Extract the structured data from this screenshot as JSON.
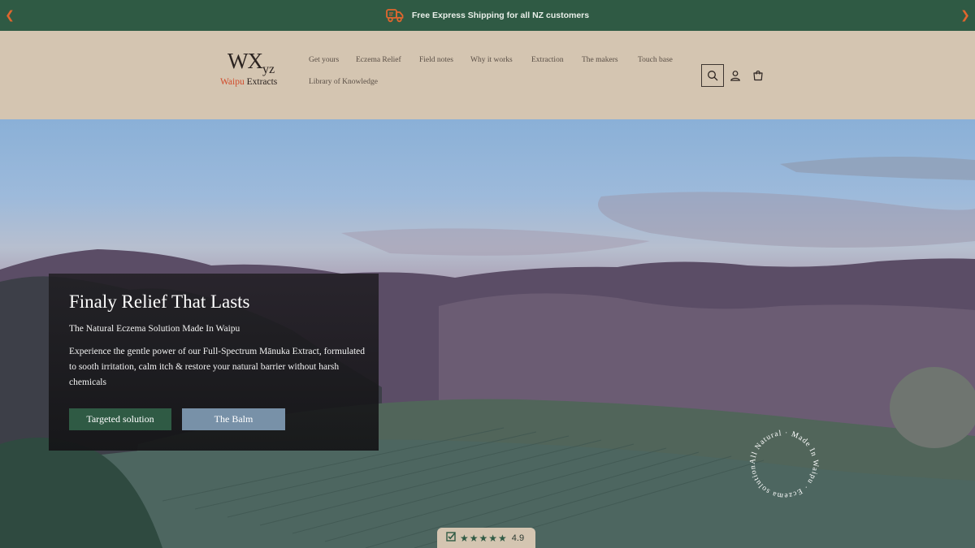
{
  "announcement": {
    "prev_icon": "chevron-left-icon",
    "next_icon": "chevron-right-icon",
    "truck_icon": "truck-icon",
    "text": "Free Express Shipping for all NZ customers"
  },
  "logo": {
    "mark": "WX",
    "mark_small": "yz",
    "sub_accent": "Waipu",
    "sub_rest": " Extracts"
  },
  "nav": {
    "items": [
      {
        "label": "Get yours"
      },
      {
        "label": "Eczema Relief"
      },
      {
        "label": "Field notes"
      },
      {
        "label": "Why it works"
      },
      {
        "label": "Extraction"
      },
      {
        "label": "The makers"
      },
      {
        "label": "Touch base"
      },
      {
        "label": "Library of Knowledge"
      }
    ]
  },
  "header_icons": {
    "search": "search-icon",
    "account": "account-icon",
    "cart": "cart-icon"
  },
  "hero": {
    "title": "Finaly Relief That Lasts",
    "subtitle": "The Natural Eczema Solution Made In Waipu",
    "body": "Experience the gentle power of our Full-Spectrum Mānuka Extract, formulated to sooth irritation, calm itch & restore your natural barrier without harsh chemicals",
    "primary_button": "Targeted solution",
    "secondary_button": "The Balm",
    "ring_text": "All Natural · Made In Waipu · Eczema solution ·"
  },
  "rating": {
    "icon": "verified-check-icon",
    "stars": "★★★★★",
    "value": "4.9"
  },
  "colors": {
    "brand_green": "#2f5a44",
    "header_bg": "#d4c5b1",
    "accent_orange": "#e0662e",
    "button_blue": "#7891a8"
  }
}
